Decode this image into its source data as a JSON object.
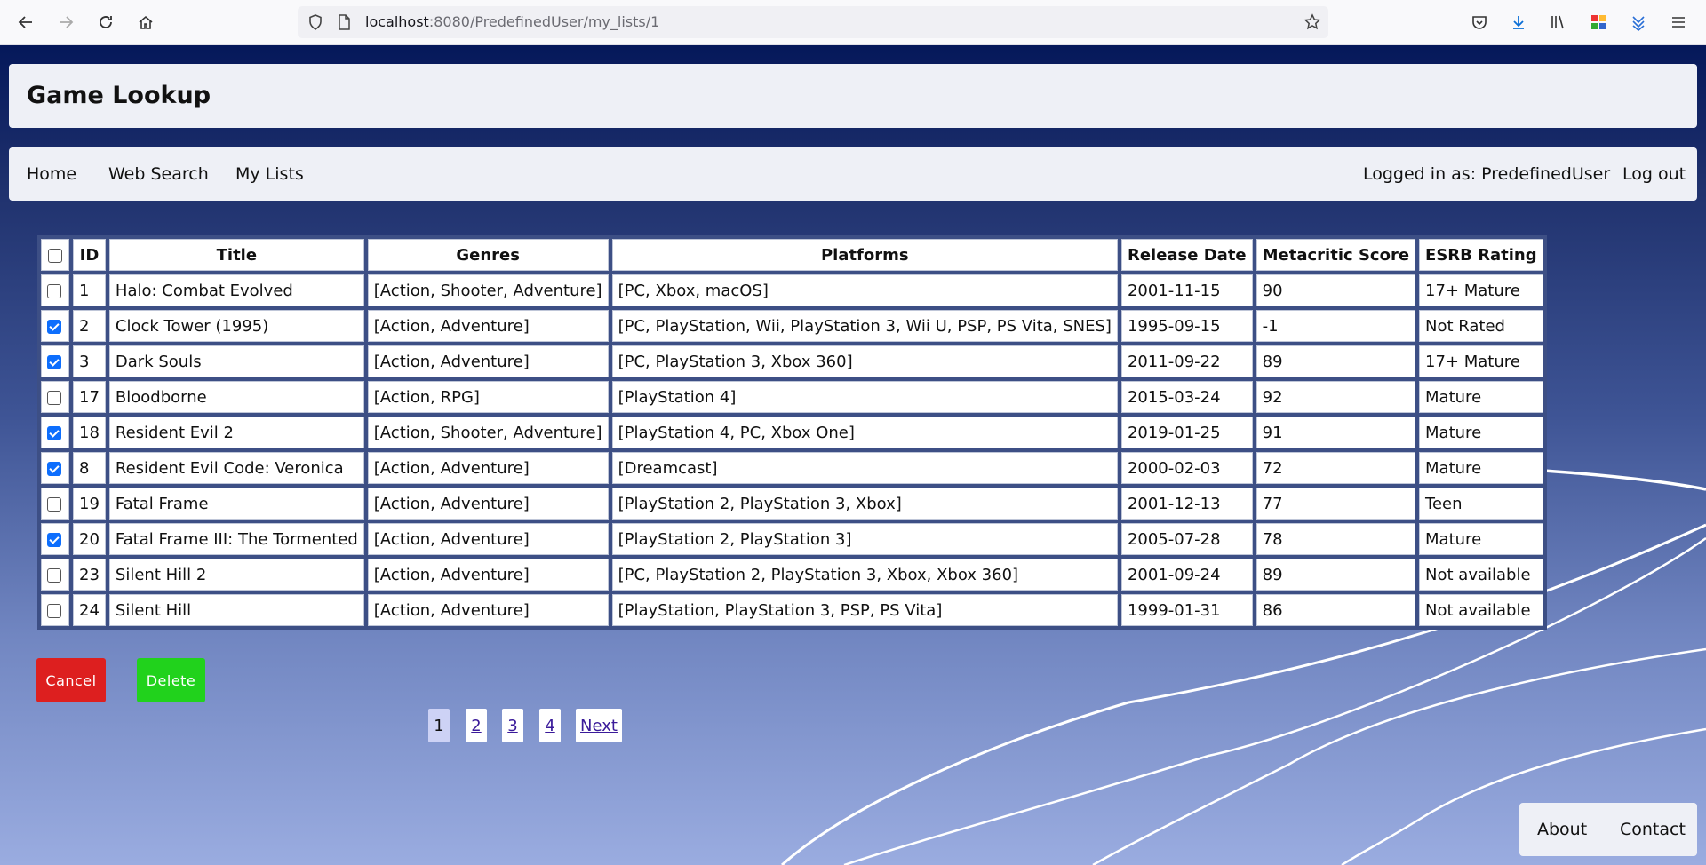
{
  "browser": {
    "url_host": "localhost",
    "url_rest": ":8080/PredefinedUser/my_lists/1"
  },
  "site": {
    "title": "Game Lookup"
  },
  "nav": {
    "home": "Home",
    "web_search": "Web Search",
    "my_lists": "My Lists",
    "logged_in": "Logged in as: PredefinedUser",
    "logout": "Log out"
  },
  "table": {
    "headers": [
      "ID",
      "Title",
      "Genres",
      "Platforms",
      "Release Date",
      "Metacritic Score",
      "ESRB Rating"
    ],
    "select_all_checked": false,
    "rows": [
      {
        "checked": false,
        "id": "1",
        "title": "Halo: Combat Evolved",
        "genres": "[Action, Shooter, Adventure]",
        "platforms": "[PC, Xbox, macOS]",
        "release": "2001-11-15",
        "score": "90",
        "esrb": "17+ Mature"
      },
      {
        "checked": true,
        "id": "2",
        "title": "Clock Tower (1995)",
        "genres": "[Action, Adventure]",
        "platforms": "[PC, PlayStation, Wii, PlayStation 3, Wii U, PSP, PS Vita, SNES]",
        "release": "1995-09-15",
        "score": "-1",
        "esrb": "Not Rated"
      },
      {
        "checked": true,
        "id": "3",
        "title": "Dark Souls",
        "genres": "[Action, Adventure]",
        "platforms": "[PC, PlayStation 3, Xbox 360]",
        "release": "2011-09-22",
        "score": "89",
        "esrb": "17+ Mature"
      },
      {
        "checked": false,
        "id": "17",
        "title": "Bloodborne",
        "genres": "[Action, RPG]",
        "platforms": "[PlayStation 4]",
        "release": "2015-03-24",
        "score": "92",
        "esrb": "Mature"
      },
      {
        "checked": true,
        "id": "18",
        "title": "Resident Evil 2",
        "genres": "[Action, Shooter, Adventure]",
        "platforms": "[PlayStation 4, PC, Xbox One]",
        "release": "2019-01-25",
        "score": "91",
        "esrb": "Mature"
      },
      {
        "checked": true,
        "id": "8",
        "title": "Resident Evil Code: Veronica",
        "genres": "[Action, Adventure]",
        "platforms": "[Dreamcast]",
        "release": "2000-02-03",
        "score": "72",
        "esrb": "Mature"
      },
      {
        "checked": false,
        "id": "19",
        "title": "Fatal Frame",
        "genres": "[Action, Adventure]",
        "platforms": "[PlayStation 2, PlayStation 3, Xbox]",
        "release": "2001-12-13",
        "score": "77",
        "esrb": "Teen"
      },
      {
        "checked": true,
        "id": "20",
        "title": "Fatal Frame III: The Tormented",
        "genres": "[Action, Adventure]",
        "platforms": "[PlayStation 2, PlayStation 3]",
        "release": "2005-07-28",
        "score": "78",
        "esrb": "Mature"
      },
      {
        "checked": false,
        "id": "23",
        "title": "Silent Hill 2",
        "genres": "[Action, Adventure]",
        "platforms": "[PC, PlayStation 2, PlayStation 3, Xbox, Xbox 360]",
        "release": "2001-09-24",
        "score": "89",
        "esrb": "Not available"
      },
      {
        "checked": false,
        "id": "24",
        "title": "Silent Hill",
        "genres": "[Action, Adventure]",
        "platforms": "[PlayStation, PlayStation 3, PSP, PS Vita]",
        "release": "1999-01-31",
        "score": "86",
        "esrb": "Not available"
      }
    ]
  },
  "actions": {
    "cancel": "Cancel",
    "delete": "Delete"
  },
  "pagination": {
    "pages": [
      "1",
      "2",
      "3",
      "4"
    ],
    "current": "1",
    "next": "Next"
  },
  "footer": {
    "about": "About",
    "contact": "Contact"
  },
  "colors": {
    "cancel": "#dd1f1f",
    "delete": "#21d21c",
    "checkbox": "#0d6efd",
    "page_bg_top": "#05185a",
    "page_bg_bottom": "#9aace0"
  }
}
